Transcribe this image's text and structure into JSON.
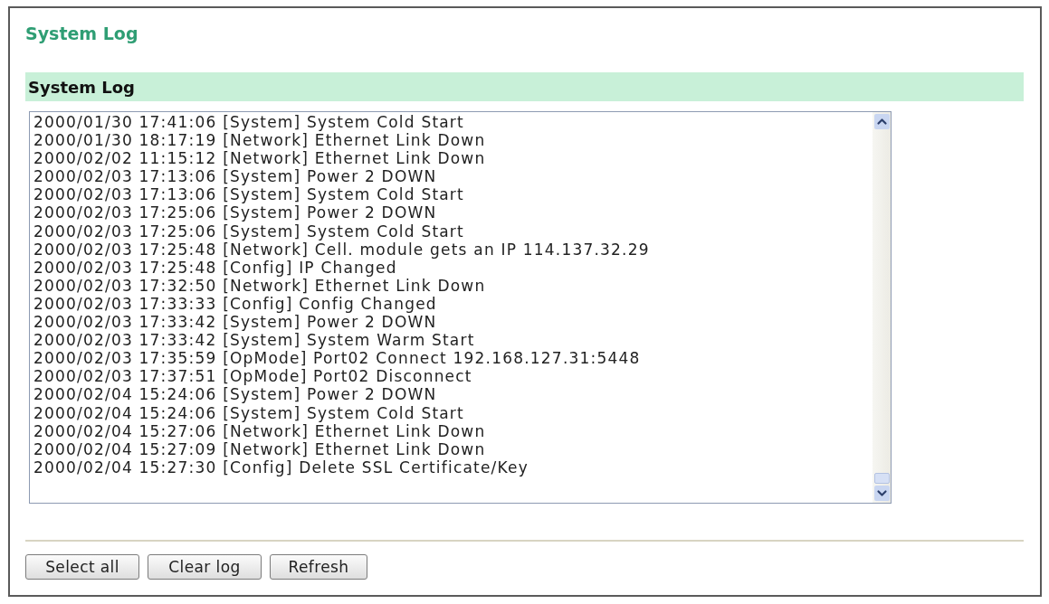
{
  "page": {
    "title": "System Log"
  },
  "section": {
    "title": "System Log"
  },
  "log": {
    "lines": [
      "2000/01/30 17:41:06 [System] System Cold Start",
      "2000/01/30 18:17:19 [Network] Ethernet Link Down",
      "2000/02/02 11:15:12 [Network] Ethernet Link Down",
      "2000/02/03 17:13:06 [System] Power 2 DOWN",
      "2000/02/03 17:13:06 [System] System Cold Start",
      "2000/02/03 17:25:06 [System] Power 2 DOWN",
      "2000/02/03 17:25:06 [System] System Cold Start",
      "2000/02/03 17:25:48 [Network] Cell. module gets an IP 114.137.32.29",
      "2000/02/03 17:25:48 [Config] IP Changed",
      "2000/02/03 17:32:50 [Network] Ethernet Link Down",
      "2000/02/03 17:33:33 [Config] Config Changed",
      "2000/02/03 17:33:42 [System] Power 2 DOWN",
      "2000/02/03 17:33:42 [System] System Warm Start",
      "2000/02/03 17:35:59 [OpMode] Port02 Connect 192.168.127.31:5448",
      "2000/02/03 17:37:51 [OpMode] Port02 Disconnect",
      "2000/02/04 15:24:06 [System] Power 2 DOWN",
      "2000/02/04 15:24:06 [System] System Cold Start",
      "2000/02/04 15:27:06 [Network] Ethernet Link Down",
      "2000/02/04 15:27:09 [Network] Ethernet Link Down",
      "2000/02/04 15:27:30 [Config] Delete SSL Certificate/Key"
    ]
  },
  "buttons": [
    {
      "label": "Select all"
    },
    {
      "label": "Clear log"
    },
    {
      "label": "Refresh"
    }
  ]
}
